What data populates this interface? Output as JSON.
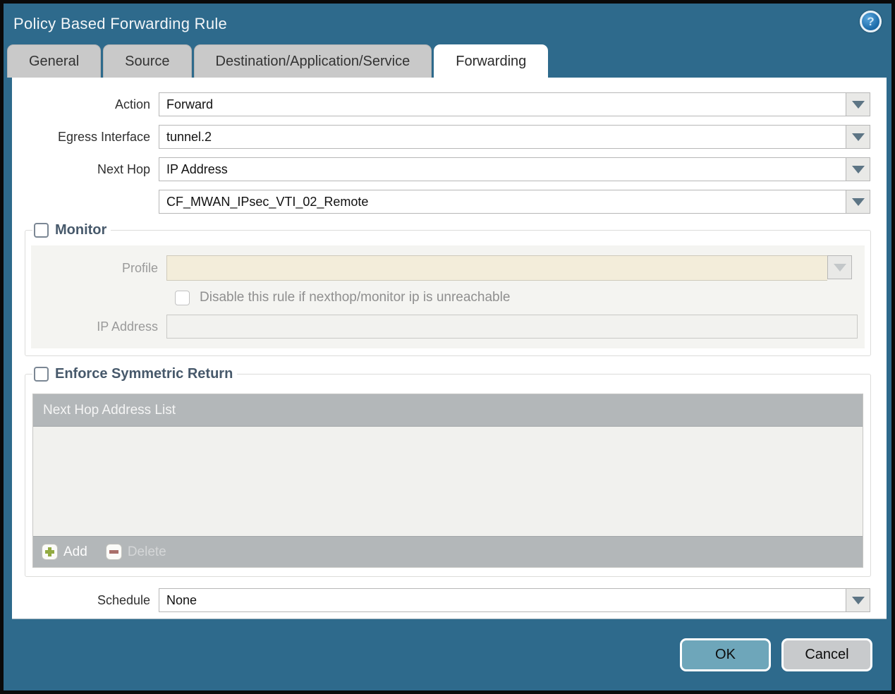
{
  "dialog": {
    "title": "Policy Based Forwarding Rule"
  },
  "tabs": [
    {
      "label": "General",
      "active": false
    },
    {
      "label": "Source",
      "active": false
    },
    {
      "label": "Destination/Application/Service",
      "active": false
    },
    {
      "label": "Forwarding",
      "active": true
    }
  ],
  "form": {
    "action": {
      "label": "Action",
      "value": "Forward"
    },
    "egress_interface": {
      "label": "Egress Interface",
      "value": "tunnel.2"
    },
    "next_hop": {
      "label": "Next Hop",
      "value": "IP Address"
    },
    "next_hop_address": {
      "value": "CF_MWAN_IPsec_VTI_02_Remote"
    },
    "schedule": {
      "label": "Schedule",
      "value": "None"
    }
  },
  "monitor": {
    "legend": "Monitor",
    "checked": false,
    "profile_label": "Profile",
    "profile_value": "",
    "disable_rule_label": "Disable this rule if nexthop/monitor ip is unreachable",
    "ip_address_label": "IP Address",
    "ip_address_value": ""
  },
  "symmetric_return": {
    "legend": "Enforce Symmetric Return",
    "checked": false,
    "table_header": "Next Hop Address List",
    "add_label": "Add",
    "delete_label": "Delete"
  },
  "footer": {
    "ok_label": "OK",
    "cancel_label": "Cancel"
  },
  "icons": {
    "help": "help-icon",
    "dropdown": "chevron-down-icon",
    "add": "plus-icon",
    "delete": "minus-icon"
  },
  "colors": {
    "titlebar_bg": "#2e6a8c",
    "tab_inactive_bg": "#c9c9c9",
    "tab_active_bg": "#ffffff",
    "ok_button_bg": "#6ea6ba",
    "cancel_button_bg": "#c8cacc",
    "table_bar_bg": "#b3b7b9",
    "disabled_profile_bg": "#f3edda",
    "add_plus_color": "#93ab41",
    "delete_minus_color": "#aa6f6a",
    "legend_text_color": "#47596b"
  }
}
